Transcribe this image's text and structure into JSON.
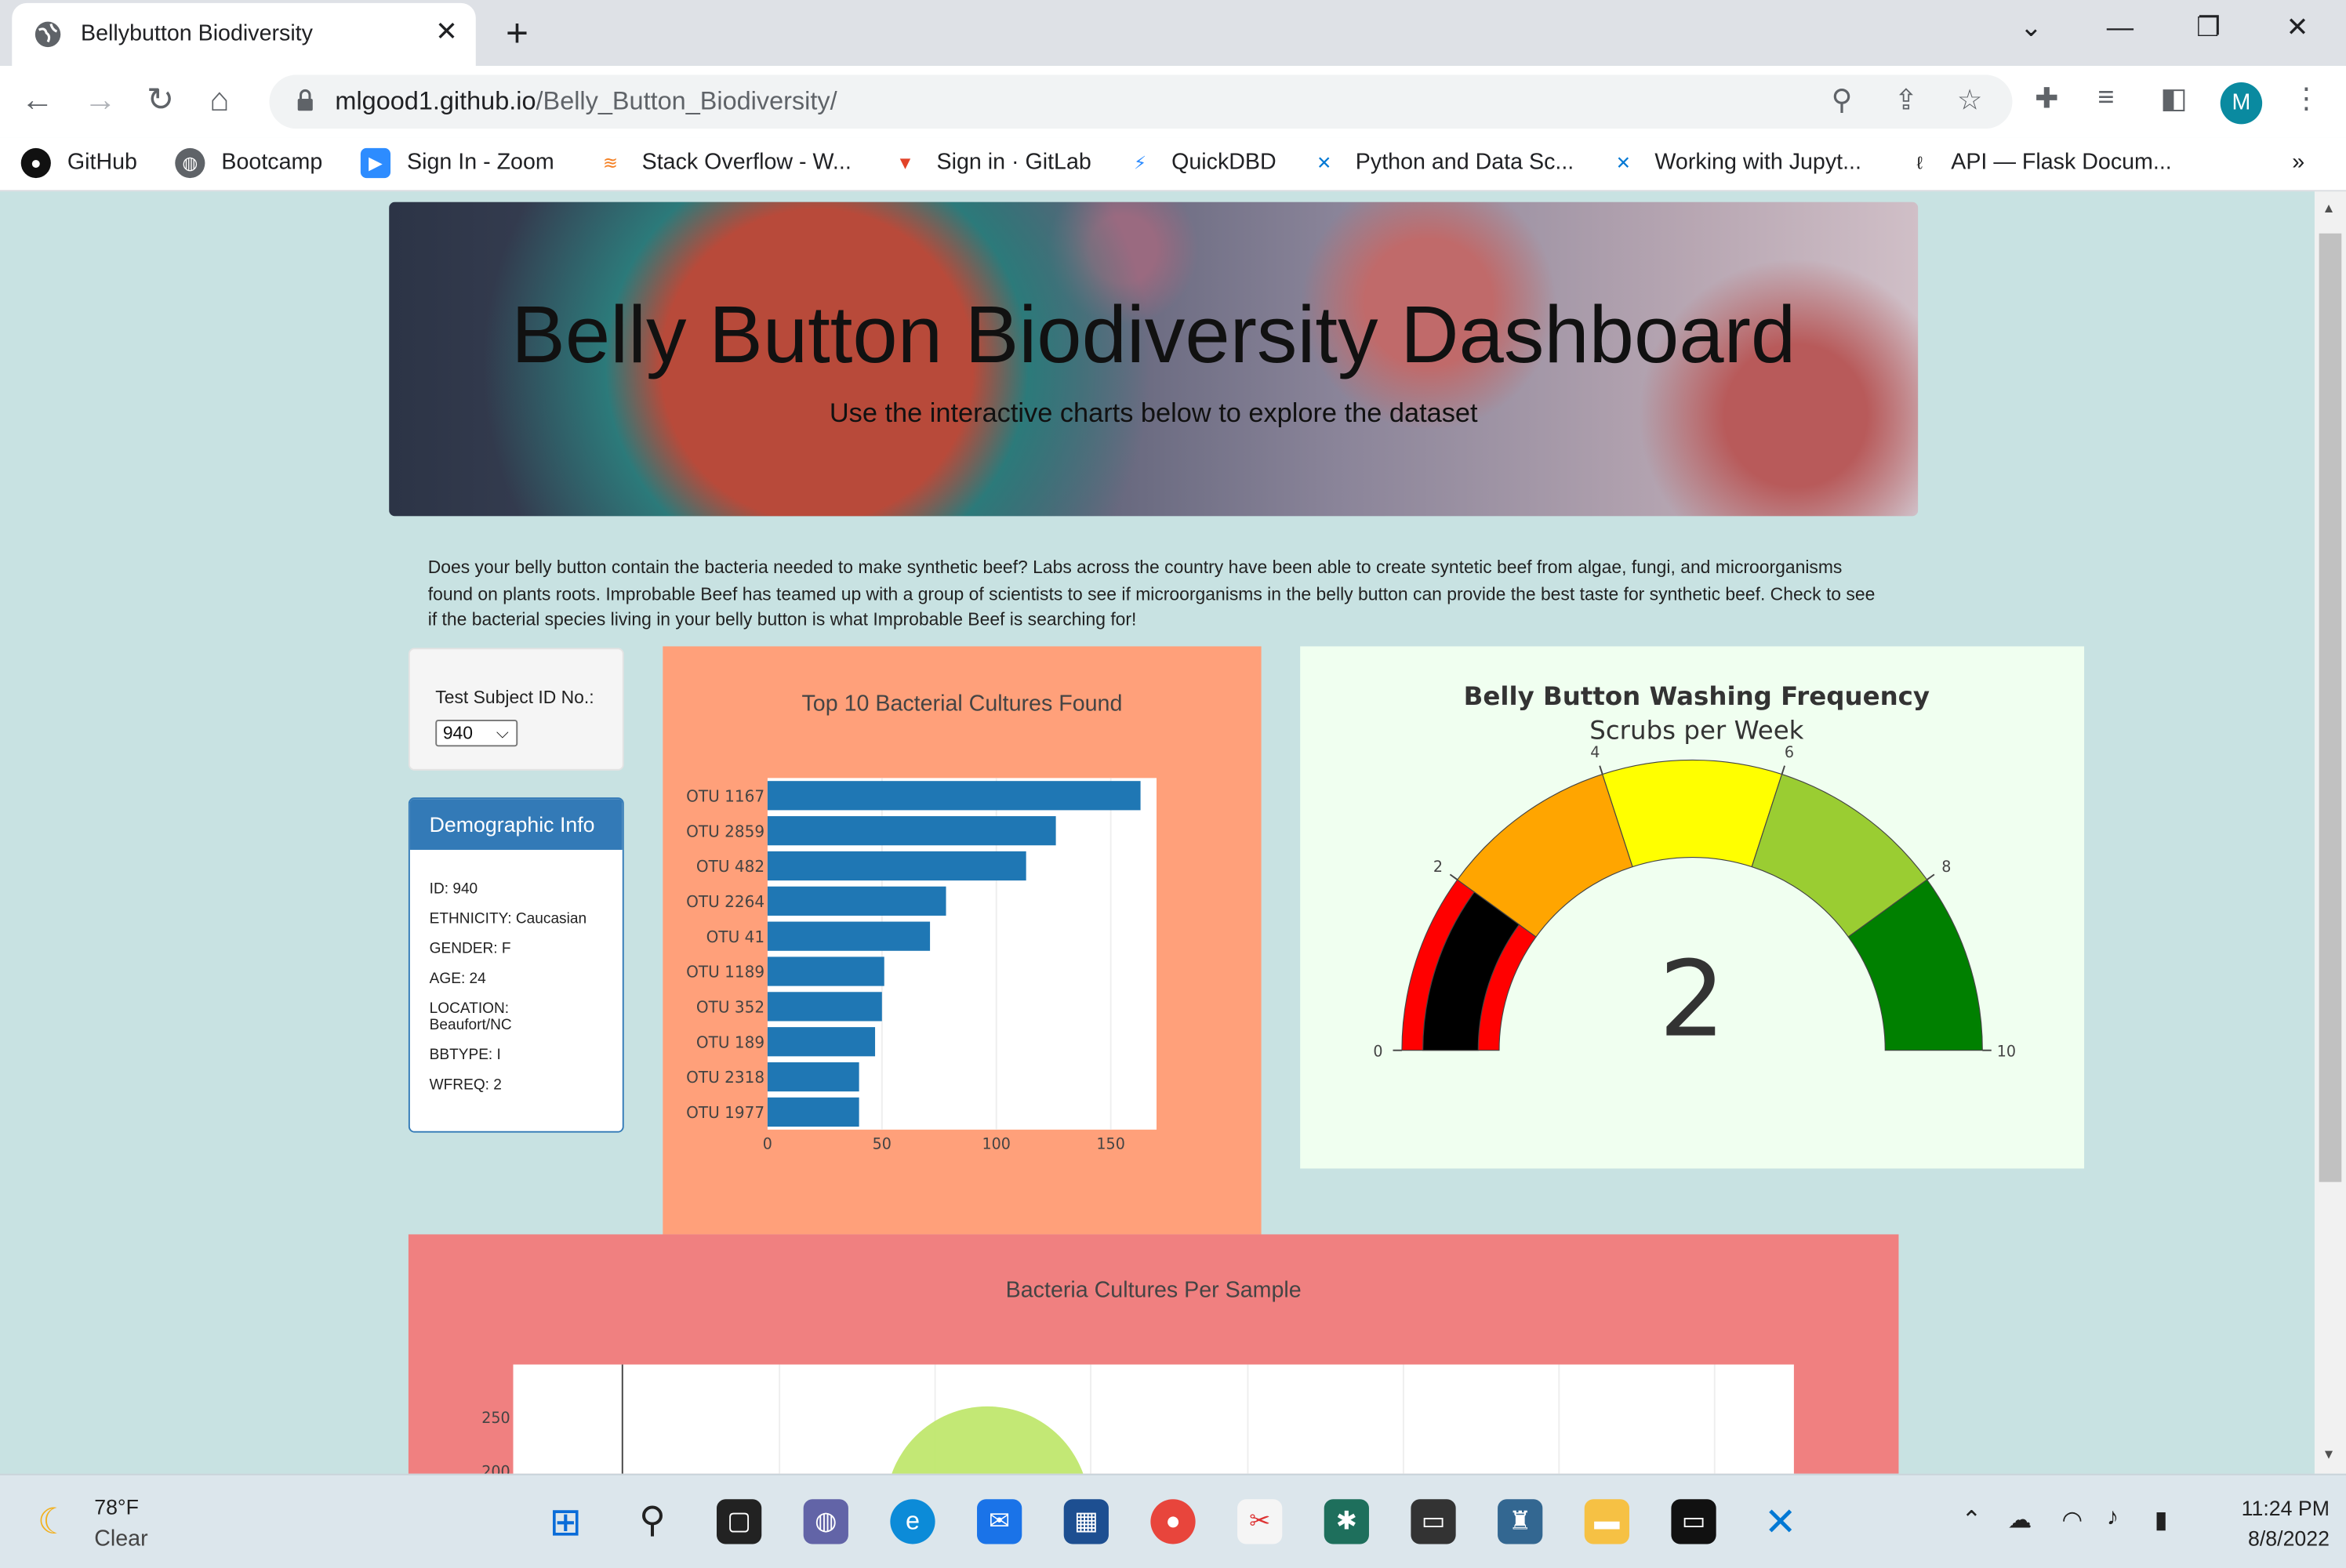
{
  "browser": {
    "tab_title": "Bellybutton Biodiversity",
    "new_tab_symbol": "+",
    "close_symbol": "✕",
    "url_host": "mlgood1.github.io",
    "url_path": "/Belly_Button_Biodiversity/",
    "profile_initial": "M",
    "bookmarks": [
      "GitHub",
      "Bootcamp",
      "Sign In - Zoom",
      "Stack Overflow - W...",
      "Sign in · GitLab",
      "QuickDBD",
      "Python and Data Sc...",
      "Working with Jupyt...",
      "API — Flask Docum..."
    ],
    "bookmarks_more": "»"
  },
  "hero": {
    "title": "Belly Button Biodiversity Dashboard",
    "subtitle": "Use the interactive charts below to explore the dataset"
  },
  "intro": "Does your belly button contain the bacteria needed to make synthetic beef? Labs across the country have been able to create syntetic beef from algae, fungi, and microorganisms found on plants roots. Improbable Beef has teamed up with a group of scientists to see if microorganisms in the belly button can provide the best taste for synthetic beef. Check to see if the bacterial species living in your belly button is what Improbable Beef is searching for!",
  "selector": {
    "label": "Test Subject ID No.:",
    "value": "940"
  },
  "demographics": {
    "title": "Demographic Info",
    "items": [
      "ID: 940",
      "ETHNICITY: Caucasian",
      "GENDER: F",
      "AGE: 24",
      "LOCATION: Beaufort/NC",
      "BBTYPE: I",
      "WFREQ: 2"
    ]
  },
  "chart_data": [
    {
      "type": "bar",
      "orientation": "horizontal",
      "title": "Top 10 Bacterial Cultures Found",
      "categories": [
        "OTU 1167",
        "OTU 2859",
        "OTU 482",
        "OTU 2264",
        "OTU 41",
        "OTU 1189",
        "OTU 352",
        "OTU 189",
        "OTU 2318",
        "OTU 1977"
      ],
      "values": [
        163,
        126,
        113,
        78,
        71,
        51,
        50,
        47,
        40,
        40
      ],
      "xlim": [
        0,
        170
      ],
      "xticks": [
        0,
        50,
        100,
        150
      ],
      "color": "#1f77b4",
      "grid": true
    },
    {
      "type": "gauge",
      "title": "Belly Button Washing Frequency",
      "subtitle": "Scrubs per Week",
      "value": 2,
      "range": [
        0,
        10
      ],
      "ticks": [
        0,
        2,
        4,
        6,
        8,
        10
      ],
      "bands": [
        {
          "from": 0,
          "to": 2,
          "color": "#ff0000"
        },
        {
          "from": 2,
          "to": 4,
          "color": "#ffa500"
        },
        {
          "from": 4,
          "to": 6,
          "color": "#ffff00"
        },
        {
          "from": 6,
          "to": 8,
          "color": "#9acd32"
        },
        {
          "from": 8,
          "to": 10,
          "color": "#008000"
        }
      ],
      "bar_color": "#000000"
    },
    {
      "type": "scatter",
      "title": "Bacteria Cultures Per Sample",
      "y_ticks_visible": [
        250,
        200
      ]
    }
  ],
  "taskbar": {
    "temperature": "78°F",
    "condition": "Clear",
    "time": "11:24 PM",
    "date": "8/8/2022"
  },
  "colors": {
    "page_bg": "#c8e2e2",
    "bar_panel": "#ffa07a",
    "gauge_panel": "#f0fff0",
    "bubble_panel": "#f08080",
    "panel_primary": "#337ab7"
  }
}
